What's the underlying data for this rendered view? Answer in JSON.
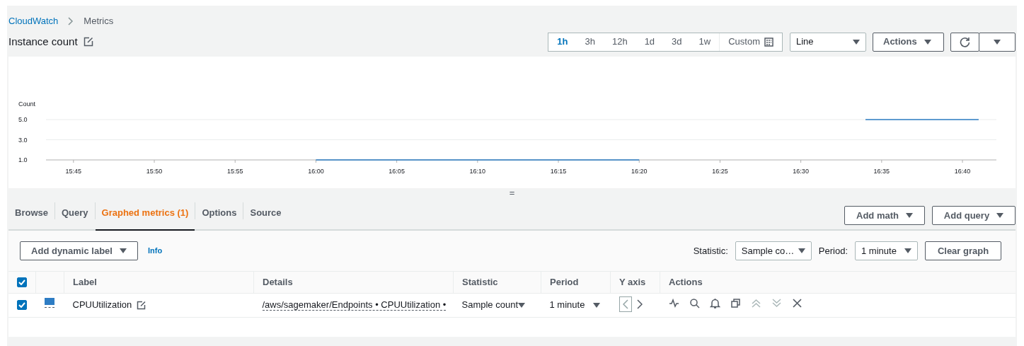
{
  "breadcrumb": [
    {
      "label": "CloudWatch",
      "kind": "link"
    },
    {
      "label": "Metrics",
      "kind": "current"
    }
  ],
  "title": "Instance count",
  "time_ranges": [
    {
      "label": "1h",
      "selected": true
    },
    {
      "label": "3h",
      "selected": false
    },
    {
      "label": "12h",
      "selected": false
    },
    {
      "label": "1d",
      "selected": false
    },
    {
      "label": "3d",
      "selected": false
    },
    {
      "label": "1w",
      "selected": false
    }
  ],
  "custom_button": "Custom",
  "chart_type_select": {
    "value": "Line"
  },
  "actions_button": "Actions",
  "chart": {
    "chart_data": {
      "type": "line",
      "ylabel": "Count",
      "categories": [
        null,
        "15:45",
        null,
        null,
        null,
        null,
        "15:50",
        null,
        null,
        null,
        null,
        "15:55",
        null,
        null,
        null,
        null,
        "16:00",
        null,
        null,
        null,
        null,
        "16:05",
        null,
        null,
        null,
        null,
        "16:10",
        null,
        null,
        null,
        null,
        "16:15",
        null,
        null,
        null,
        null,
        "16:20",
        null,
        null,
        null,
        null,
        "16:25",
        null,
        null,
        null,
        null,
        "16:30",
        null,
        null,
        null,
        null,
        "16:35",
        null,
        null,
        null,
        null,
        "16:40",
        null
      ],
      "series": [
        {
          "color": "#2e7dc4",
          "values": [
            null,
            null,
            null,
            null,
            null,
            null,
            null,
            null,
            null,
            null,
            null,
            null,
            null,
            null,
            null,
            null,
            1,
            1,
            1,
            1,
            1,
            1,
            1,
            1,
            1,
            1,
            1,
            1,
            1,
            1,
            1,
            1,
            1,
            1,
            1,
            1,
            1,
            null,
            null,
            null,
            null,
            null,
            null,
            null,
            null,
            null,
            null,
            null,
            null,
            null,
            5,
            5,
            5,
            5,
            5,
            5,
            5,
            5
          ]
        }
      ],
      "ylim": [
        1,
        5
      ],
      "yticks": [
        {
          "value": 1,
          "label": "1.0"
        },
        {
          "value": 3,
          "label": "3.0"
        },
        {
          "value": 5,
          "label": "5.0"
        }
      ]
    }
  },
  "splitter": "=",
  "tabs": [
    {
      "label": "Browse",
      "selected": false
    },
    {
      "label": "Query",
      "selected": false
    },
    {
      "label": "Graphed metrics (1)",
      "selected": true
    },
    {
      "label": "Options",
      "selected": false
    },
    {
      "label": "Source",
      "selected": false
    }
  ],
  "tab_buttons": [
    "Add math",
    "Add query"
  ],
  "toolbar": {
    "dynamic_label_button": "Add dynamic label",
    "info_link": "Info",
    "statistic_label": "Statistic:",
    "statistic_value": "Sample co…",
    "period_label": "Period:",
    "period_value": "1 minute",
    "clear_button": "Clear graph"
  },
  "table": {
    "columns": [
      "Label",
      "Details",
      "Statistic",
      "Period",
      "Y axis",
      "Actions"
    ],
    "all_checked": true,
    "rows": [
      {
        "checked": true,
        "color": "#2e7dc4",
        "label": "CPUUtilization",
        "details": "/aws/sagemaker/Endpoints • CPUUtilization •",
        "statistic": "Sample count",
        "period": "1 minute",
        "y_axis_left": true
      }
    ]
  }
}
